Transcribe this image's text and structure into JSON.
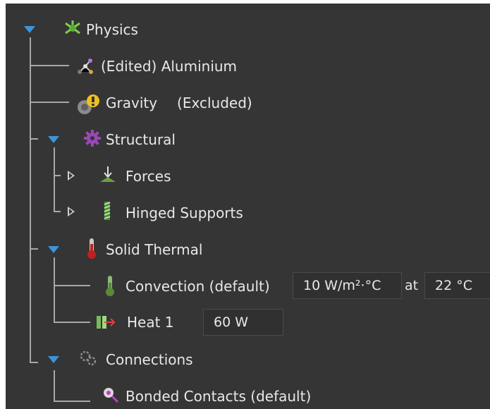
{
  "tree": {
    "physics": {
      "label": "Physics",
      "icon": "physics-icon"
    },
    "material": {
      "label": "(Edited) Aluminium",
      "icon": "material-icon"
    },
    "gravity": {
      "label": "Gravity",
      "status": "(Excluded)",
      "icon": "gravity-icon"
    },
    "structural": {
      "label": "Structural",
      "icon": "structural-gear-icon"
    },
    "forces": {
      "label": "Forces",
      "icon": "force-arrow-icon"
    },
    "hinged_supports": {
      "label": "Hinged Supports",
      "icon": "hinged-support-icon"
    },
    "solid_thermal": {
      "label": "Solid Thermal",
      "icon": "thermometer-icon"
    },
    "convection": {
      "label": "Convection (default)",
      "coefficient": "10 W/m²·°C",
      "at_label": "at",
      "temperature": "22 °C",
      "icon": "convection-thermometer-icon"
    },
    "heat1": {
      "label": "Heat 1",
      "power": "60 W",
      "icon": "heat-source-icon"
    },
    "connections": {
      "label": "Connections",
      "icon": "connections-gears-icon"
    },
    "bonded_contacts": {
      "label": "Bonded Contacts (default)",
      "icon": "bonded-contact-icon"
    }
  }
}
